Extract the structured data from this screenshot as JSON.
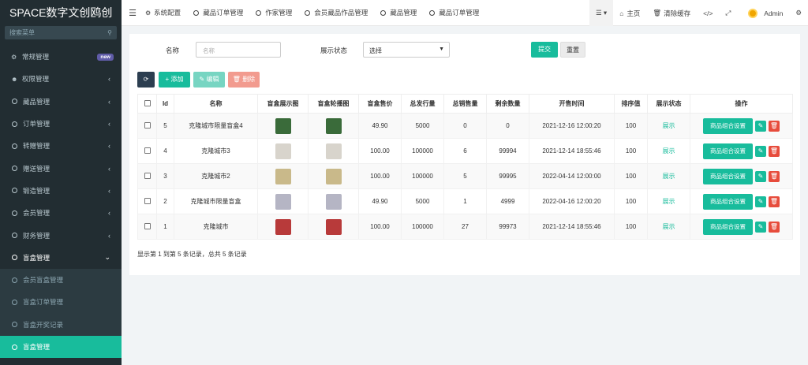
{
  "brand": "SPACE数字文创鸥创",
  "sidebar": {
    "search_placeholder": "搜索菜单",
    "items": [
      {
        "label": "常规管理",
        "icon": "cogs-icon",
        "badge": "new"
      },
      {
        "label": "权限管理",
        "icon": "users-icon"
      },
      {
        "label": "藏品管理",
        "icon": "circle-icon"
      },
      {
        "label": "订单管理",
        "icon": "circle-icon"
      },
      {
        "label": "转赠管理",
        "icon": "circle-icon"
      },
      {
        "label": "赠送管理",
        "icon": "circle-icon"
      },
      {
        "label": "锻造管理",
        "icon": "circle-icon"
      },
      {
        "label": "会员管理",
        "icon": "circle-icon"
      },
      {
        "label": "财务管理",
        "icon": "circle-icon"
      },
      {
        "label": "盲盒管理",
        "icon": "circle-icon"
      }
    ],
    "sub_items": [
      {
        "label": "会员盲盒管理"
      },
      {
        "label": "盲盒订单管理"
      },
      {
        "label": "盲盒开奖记录"
      },
      {
        "label": "盲盒管理"
      }
    ]
  },
  "topbar": {
    "tabs": [
      {
        "label": "系统配置"
      },
      {
        "label": "藏品订单管理"
      },
      {
        "label": "作家管理"
      },
      {
        "label": "会员藏品作品管理"
      },
      {
        "label": "藏品管理"
      },
      {
        "label": "藏品订单管理"
      }
    ],
    "home": "主页",
    "clear_cache": "清除缓存",
    "user": "Admin"
  },
  "filter": {
    "name_label": "名称",
    "name_placeholder": "名称",
    "status_label": "展示状态",
    "status_value": "选择",
    "submit": "提交",
    "reset": "重置"
  },
  "toolbar": {
    "add": "添加",
    "edit": "编辑",
    "delete": "删除"
  },
  "table": {
    "headers": [
      "Id",
      "名称",
      "盲盒展示图",
      "盲盒轮播图",
      "盲盒售价",
      "总发行量",
      "总销售量",
      "剩余数量",
      "开售时间",
      "排序值",
      "展示状态",
      "操作"
    ],
    "rows": [
      {
        "id": "5",
        "name": "克隆城市限量盲盒4",
        "price": "49.90",
        "total": "5000",
        "sold": "0",
        "left": "0",
        "time": "2021-12-16 12:00:20",
        "sort": "100",
        "status": "展示",
        "thumb_color": "#3a6b3a"
      },
      {
        "id": "4",
        "name": "克隆城市3",
        "price": "100.00",
        "total": "100000",
        "sold": "6",
        "left": "99994",
        "time": "2021-12-14 18:55:46",
        "sort": "100",
        "status": "展示",
        "thumb_color": "#d8d4cc"
      },
      {
        "id": "3",
        "name": "克隆城市2",
        "price": "100.00",
        "total": "100000",
        "sold": "5",
        "left": "99995",
        "time": "2022-04-14 12:00:00",
        "sort": "100",
        "status": "展示",
        "thumb_color": "#c9b98a"
      },
      {
        "id": "2",
        "name": "克隆城市限量盲盒",
        "price": "49.90",
        "total": "5000",
        "sold": "1",
        "left": "4999",
        "time": "2022-04-16 12:00:20",
        "sort": "100",
        "status": "展示",
        "thumb_color": "#b5b5c4"
      },
      {
        "id": "1",
        "name": "克隆城市",
        "price": "100.00",
        "total": "100000",
        "sold": "27",
        "left": "99973",
        "time": "2021-12-14 18:55:46",
        "sort": "100",
        "status": "展示",
        "thumb_color": "#b83a3a"
      }
    ],
    "op_label": "商品组合设置"
  },
  "pager_info": "显示第 1 到第 5 条记录，总共 5 条记录"
}
